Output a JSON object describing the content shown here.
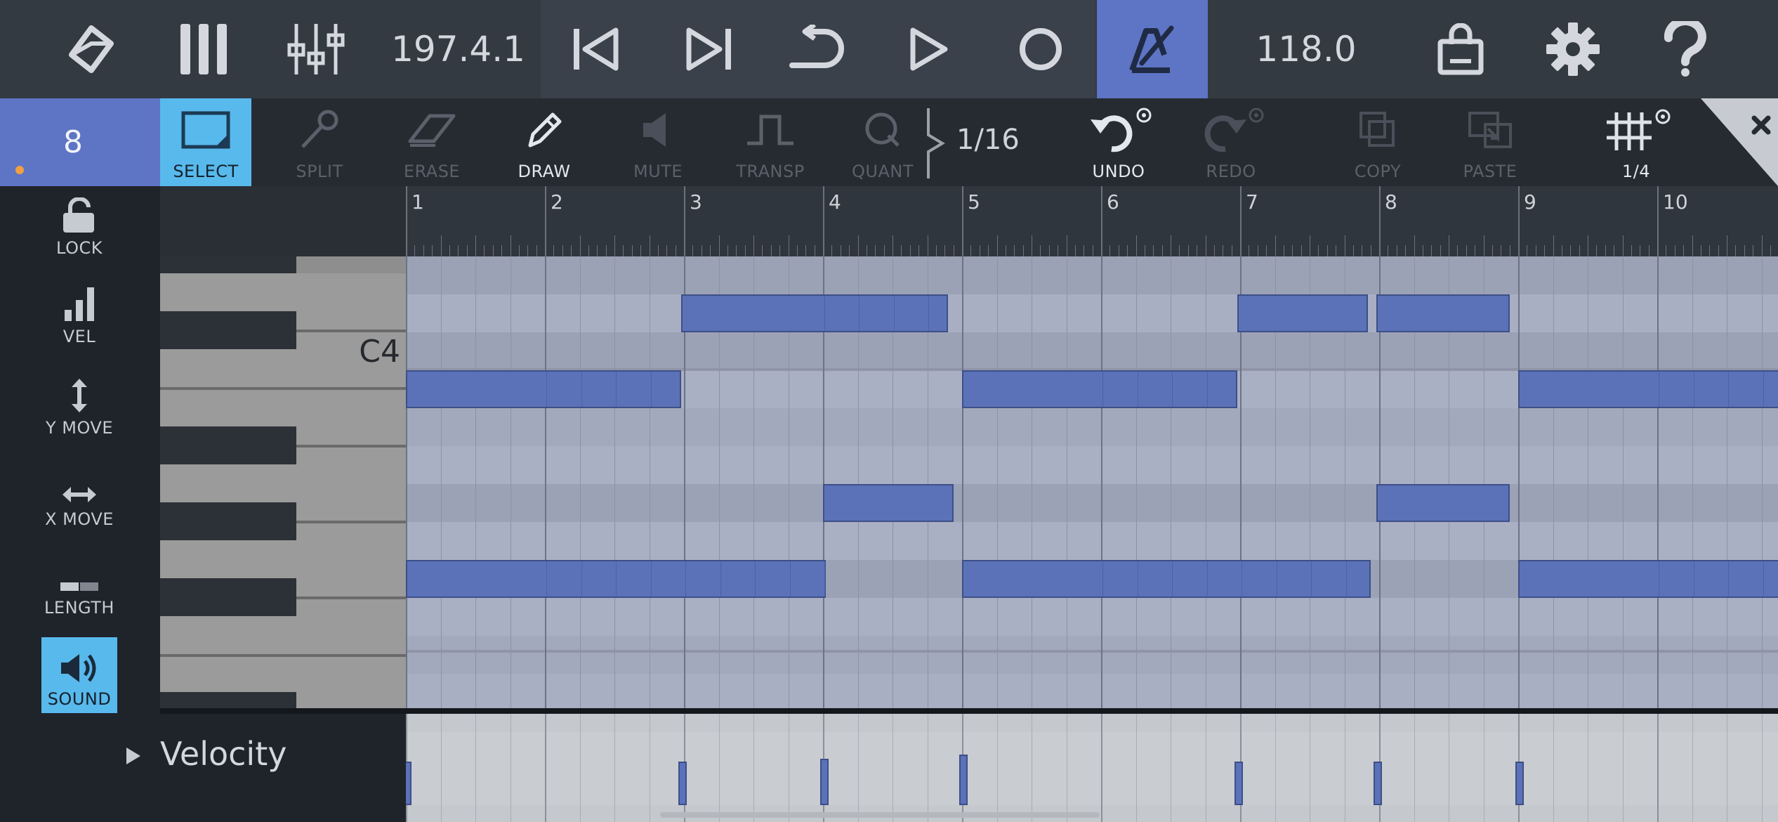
{
  "transport": {
    "position": "197.4.1",
    "tempo": "118.0",
    "icons": [
      "cube-icon",
      "keyboard-icon",
      "mixer-icon",
      "skip-back-icon",
      "skip-forward-icon",
      "loop-icon",
      "play-icon",
      "record-icon",
      "metronome-icon",
      "shop-bag-icon",
      "gear-icon",
      "help-icon"
    ],
    "metronome_active": true,
    "accent_color": "#5e74c4"
  },
  "toolbar": {
    "track_number": "8",
    "tools": [
      {
        "label": "SELECT",
        "state": "active"
      },
      {
        "label": "SPLIT",
        "state": "disabled"
      },
      {
        "label": "ERASE",
        "state": "disabled"
      },
      {
        "label": "DRAW",
        "state": "enabled"
      },
      {
        "label": "MUTE",
        "state": "disabled"
      },
      {
        "label": "TRANSP",
        "state": "disabled"
      },
      {
        "label": "QUANT",
        "state": "disabled"
      }
    ],
    "quantize_value": "1/16",
    "undo_label": "UNDO",
    "redo_label": "REDO",
    "copy_label": "COPY",
    "paste_label": "PASTE",
    "grid_value": "1/4",
    "select_color": "#58b9ec"
  },
  "sidebar": {
    "items": [
      {
        "label": "LOCK",
        "active": false
      },
      {
        "label": "VEL",
        "active": false
      },
      {
        "label": "Y MOVE",
        "active": false
      },
      {
        "label": "X MOVE",
        "active": false
      },
      {
        "label": "LENGTH",
        "active": false
      },
      {
        "label": "SOUND",
        "active": true
      }
    ]
  },
  "piano_roll": {
    "key_label": "C4",
    "bar_numbers": [
      "1",
      "2",
      "3",
      "4",
      "5",
      "6",
      "7",
      "8",
      "9",
      "10"
    ],
    "note_color": "#5b72b8",
    "notes": [
      {
        "row": 1,
        "start_bar": 2.98,
        "end_bar": 4.9
      },
      {
        "row": 1,
        "start_bar": 6.98,
        "end_bar": 7.92
      },
      {
        "row": 1,
        "start_bar": 7.98,
        "end_bar": 8.94
      },
      {
        "row": 3,
        "start_bar": 1.0,
        "end_bar": 2.98
      },
      {
        "row": 3,
        "start_bar": 5.0,
        "end_bar": 6.98
      },
      {
        "row": 3,
        "start_bar": 9.0,
        "end_bar": 11.0
      },
      {
        "row": 6,
        "start_bar": 4.0,
        "end_bar": 4.94
      },
      {
        "row": 6,
        "start_bar": 7.98,
        "end_bar": 8.94
      },
      {
        "row": 8,
        "start_bar": 1.0,
        "end_bar": 4.02
      },
      {
        "row": 8,
        "start_bar": 5.0,
        "end_bar": 7.94
      },
      {
        "row": 8,
        "start_bar": 9.0,
        "end_bar": 11.0
      }
    ]
  },
  "velocity": {
    "label": "Velocity",
    "events": [
      {
        "bar": 1.0,
        "value": 0.62
      },
      {
        "bar": 2.98,
        "value": 0.62
      },
      {
        "bar": 4.0,
        "value": 0.66
      },
      {
        "bar": 5.0,
        "value": 0.72
      },
      {
        "bar": 6.98,
        "value": 0.62
      },
      {
        "bar": 7.98,
        "value": 0.62
      },
      {
        "bar": 9.0,
        "value": 0.62
      }
    ]
  }
}
